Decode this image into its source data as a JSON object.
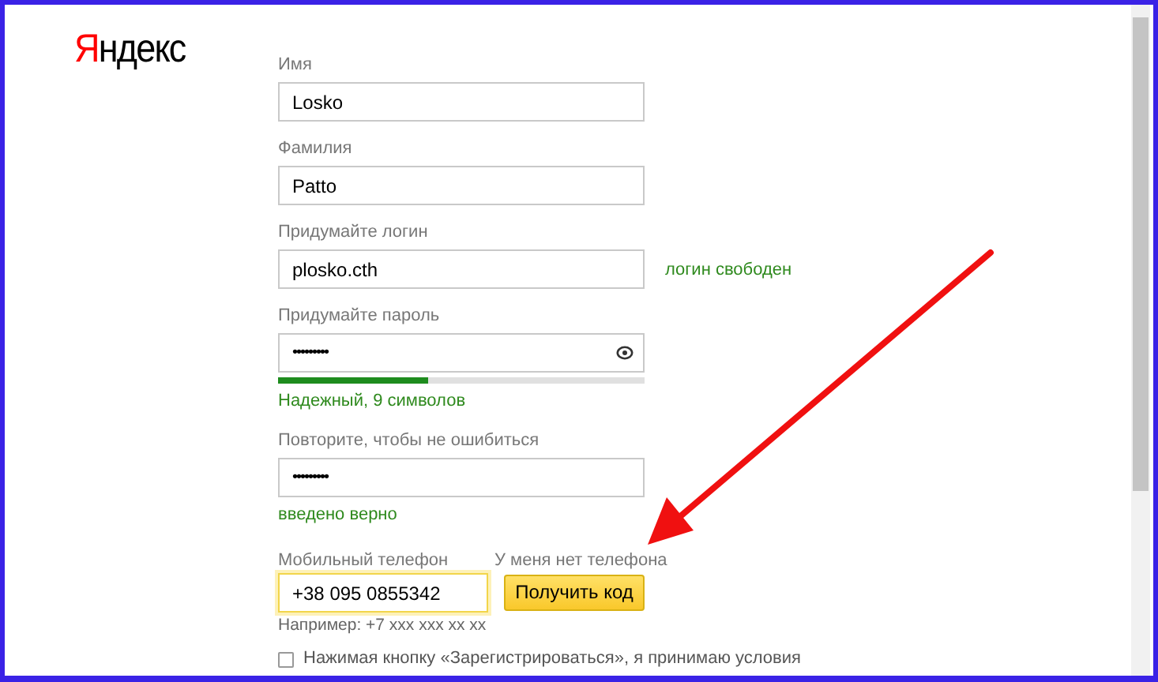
{
  "logo": "Яндекс",
  "fields": [
    {
      "kind": "text",
      "label": "Имя",
      "value": "Losko"
    },
    {
      "kind": "text",
      "label": "Фамилия",
      "value": "Patto"
    },
    {
      "kind": "text",
      "label": "Придумайте логин",
      "value": "plosko.cth",
      "status": "логин свободен"
    },
    {
      "kind": "password",
      "label": "Придумайте пароль",
      "value": "•••••••••",
      "reveal_icon": true,
      "strength": {
        "level": 0.41
      },
      "status": "Надежный, 9 символов"
    },
    {
      "kind": "password",
      "label": "Повторите, чтобы не ошибиться",
      "value": "•••••••••",
      "reveal_icon": false,
      "status": "введено верно"
    },
    {
      "kind": "phone",
      "label": "Мобильный телефон",
      "value": "+38 095 0855342",
      "focused": true,
      "alt_link": "У меня нет телефона",
      "button": "Получить код",
      "example": "Например: +7 xxx xxx xx xx"
    }
  ],
  "agreement": {
    "checked": false,
    "text": "Нажимая кнопку «Зарегистрироваться», я принимаю условия"
  }
}
